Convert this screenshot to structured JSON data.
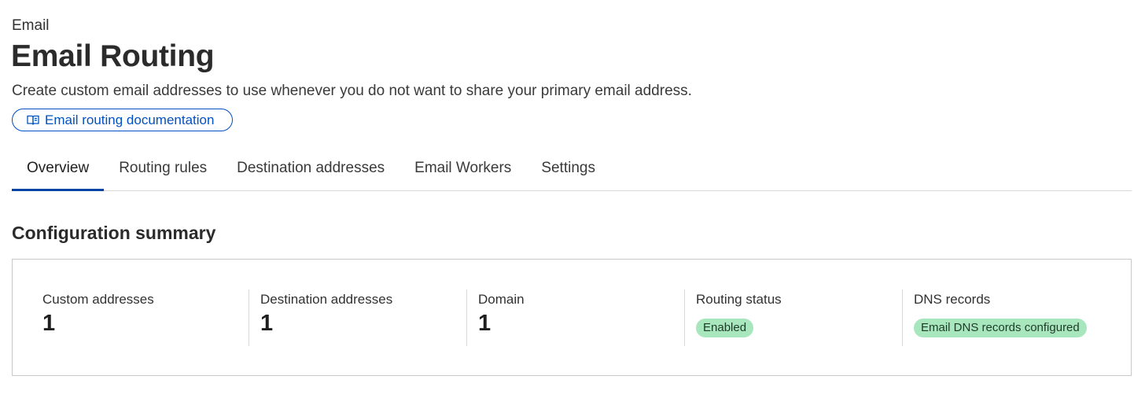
{
  "header": {
    "breadcrumb": "Email",
    "title": "Email Routing",
    "description": "Create custom email addresses to use whenever you do not want to share your primary email address.",
    "doc_link_label": "Email routing documentation",
    "doc_link_icon": "book-icon",
    "link_color": "#0051c3"
  },
  "tabs": [
    {
      "label": "Overview",
      "active": true
    },
    {
      "label": "Routing rules",
      "active": false
    },
    {
      "label": "Destination addresses",
      "active": false
    },
    {
      "label": "Email Workers",
      "active": false
    },
    {
      "label": "Settings",
      "active": false
    }
  ],
  "summary": {
    "title": "Configuration summary",
    "stats": [
      {
        "label": "Custom addresses",
        "value": "1"
      },
      {
        "label": "Destination addresses",
        "value": "1"
      },
      {
        "label": "Domain",
        "value": "1"
      },
      {
        "label": "Routing status",
        "badge": "Enabled"
      },
      {
        "label": "DNS records",
        "badge": "Email DNS records configured"
      }
    ],
    "badge_color": "#a8e6bd"
  }
}
